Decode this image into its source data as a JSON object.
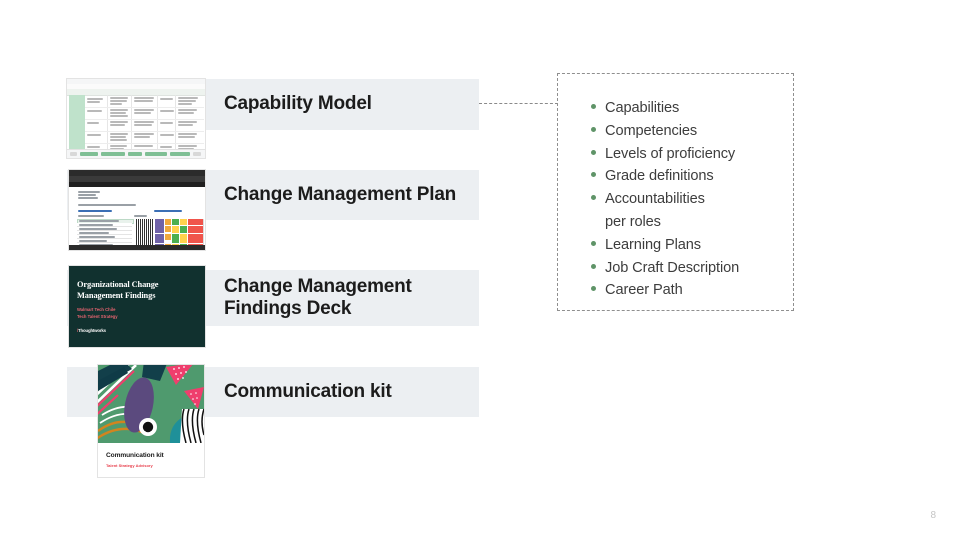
{
  "slide": {
    "page_number": "8",
    "accent_green": "#5f9468",
    "bar_background": "#eceff2",
    "panel_border": "#8f8f8f"
  },
  "rows": [
    {
      "title": "Capability Model",
      "thumbnail_name": "capability-model-spreadsheet-thumbnail",
      "has_connector": true
    },
    {
      "title": "Change Management Plan",
      "thumbnail_name": "change-management-plan-spreadsheet-thumbnail",
      "has_connector": false
    },
    {
      "title": "Change Management\nFindings Deck",
      "title_line_1": "Change Management",
      "title_line_2": "Findings Deck",
      "thumbnail_name": "change-management-findings-deck-thumbnail",
      "has_connector": false
    },
    {
      "title": "Communication kit",
      "thumbnail_name": "communication-kit-thumbnail",
      "has_connector": false
    }
  ],
  "thumbnails": {
    "findings_deck": {
      "title_line_1": "Organizational Change",
      "title_line_2": "Management Findings",
      "subtitle_line_1": "Walmart Tech Chile",
      "subtitle_line_2": "Tech Talent Strategy",
      "logo": "Thoughtworks",
      "background": "#11312f",
      "accent": "#e4636f"
    },
    "communication_kit": {
      "card_title": "Communication kit",
      "card_subtitle": "Talent Strategy Advisory",
      "accent": "#e8424f"
    }
  },
  "panel": {
    "items": [
      {
        "label": "Capabilities",
        "bullet": true
      },
      {
        "label": "Competencies",
        "bullet": true
      },
      {
        "label": "Levels of proficiency",
        "bullet": true
      },
      {
        "label": "Grade definitions",
        "bullet": true
      },
      {
        "label": "Accountabilities",
        "bullet": true
      },
      {
        "label": "per roles",
        "bullet": false
      },
      {
        "label": "Learning Plans",
        "bullet": true
      },
      {
        "label": "Job Craft Description",
        "bullet": true
      },
      {
        "label": "Career Path",
        "bullet": true
      }
    ]
  }
}
